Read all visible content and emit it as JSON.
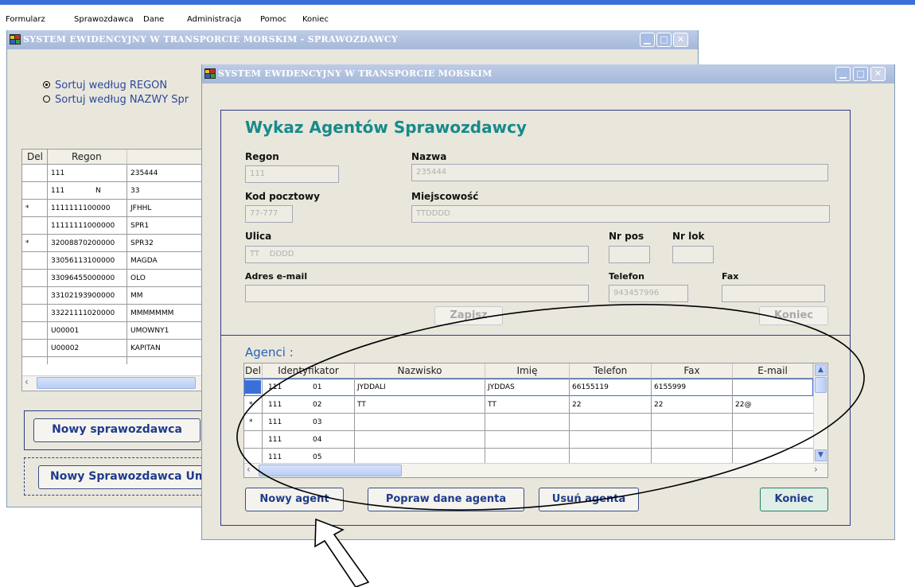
{
  "menu": [
    "Formularz",
    "Sprawozdawca",
    "Dane",
    "Administracja",
    "Pomoc",
    "Koniec"
  ],
  "colors": {
    "accent": "#3a6fd8",
    "title_teal": "#178a8a",
    "button_text": "#1f3b8c",
    "window_bg": "#e9e6dc",
    "frame_border": "#2b3f87"
  },
  "back_window": {
    "title": "SYSTEM EWIDENCYJNY W TRANSPORCIE MORSKIM - SPRAWOZDAWCY",
    "sort_options": [
      {
        "label": "Sortuj według REGON",
        "selected": true
      },
      {
        "label": "Sortuj według NAZWY Spr",
        "selected": false
      }
    ],
    "grid": {
      "headers": [
        "Del",
        "Regon"
      ],
      "rows": [
        {
          "mark": "",
          "regon": "111",
          "n": "",
          "name": "235444"
        },
        {
          "mark": "",
          "regon": "111",
          "n": "N",
          "name": "33"
        },
        {
          "mark": "*",
          "regon": "1111111100000",
          "n": "",
          "name": "JFHHL"
        },
        {
          "mark": "",
          "regon": "11111111000000",
          "n": "",
          "name": "SPR1"
        },
        {
          "mark": "*",
          "regon": "32008870200000",
          "n": "",
          "name": "SPR32"
        },
        {
          "mark": "",
          "regon": "33056113100000",
          "n": "",
          "name": "MAGDA"
        },
        {
          "mark": "",
          "regon": "33096455000000",
          "n": "",
          "name": "OLO"
        },
        {
          "mark": "",
          "regon": "33102193900000",
          "n": "",
          "name": "MM"
        },
        {
          "mark": "",
          "regon": "33221111020000",
          "n": "",
          "name": "MMMMMMM"
        },
        {
          "mark": "",
          "regon": "U00001",
          "n": "",
          "name": "UMOWNY1"
        },
        {
          "mark": "",
          "regon": "U00002",
          "n": "",
          "name": "KAPITAN"
        }
      ]
    },
    "new_reporter_button": "Nowy sprawozdawca",
    "new_reporter_contract_button": "Nowy Sprawozdawca Um"
  },
  "front_window": {
    "title": "SYSTEM  EWIDENCYJNY  W  TRANSPORCIE  MORSKIM",
    "heading": "Wykaz Agentów Sprawozdawcy",
    "fields": {
      "regon": {
        "label": "Regon",
        "value": "111"
      },
      "nazwa": {
        "label": "Nazwa",
        "value": "235444"
      },
      "kod": {
        "label": "Kod pocztowy",
        "value": "77-777"
      },
      "miejscowosc": {
        "label": "Miejscowość",
        "value": "TTDDDD"
      },
      "ulica": {
        "label": "Ulica",
        "value": "TT    DDDD"
      },
      "nr_pos": {
        "label": "Nr pos",
        "value": ""
      },
      "nr_lok": {
        "label": "Nr lok",
        "value": ""
      },
      "email": {
        "label": "Adres e-mail",
        "value": ""
      },
      "telefon": {
        "label": "Telefon",
        "value": "943457996"
      },
      "fax": {
        "label": "Fax",
        "value": ""
      }
    },
    "save_button": "Zapisz",
    "close_button_top": "Koniec",
    "agents_label": "Agenci :",
    "grid": {
      "headers": [
        "Del",
        "Identyfikator",
        "Nazwisko",
        "Imię",
        "Telefon",
        "Fax",
        "E-mail"
      ],
      "rows": [
        {
          "mark": "",
          "regon": "111",
          "num": "01",
          "nazwisko": "JYDDALI",
          "imie": "JYDDAS",
          "telefon": "66155119",
          "fax": "6155999",
          "email": ""
        },
        {
          "mark": "*",
          "regon": "111",
          "num": "02",
          "nazwisko": "TT",
          "imie": "TT",
          "telefon": "22",
          "fax": "22",
          "email": "22@"
        },
        {
          "mark": "*",
          "regon": "111",
          "num": "03",
          "nazwisko": "",
          "imie": "",
          "telefon": "",
          "fax": "",
          "email": ""
        },
        {
          "mark": "",
          "regon": "111",
          "num": "04",
          "nazwisko": "",
          "imie": "",
          "telefon": "",
          "fax": "",
          "email": ""
        },
        {
          "mark": "",
          "regon": "111",
          "num": "05",
          "nazwisko": "",
          "imie": "",
          "telefon": "",
          "fax": "",
          "email": ""
        }
      ]
    },
    "buttons": {
      "new_agent": "Nowy agent",
      "edit_agent": "Popraw dane agenta",
      "delete_agent": "Usuń agenta",
      "close": "Koniec"
    }
  }
}
